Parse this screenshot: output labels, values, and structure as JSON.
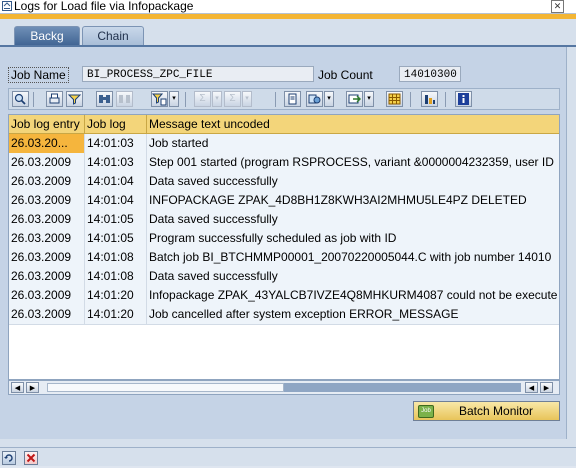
{
  "window": {
    "title": "Logs for Load file via Infopackage",
    "close_glyph": "✕"
  },
  "tabs": [
    {
      "label": "Backg",
      "active": true
    },
    {
      "label": "Chain",
      "active": false
    }
  ],
  "job": {
    "name_label": "Job Name",
    "name_value": "BI_PROCESS_ZPC_FILE",
    "count_label": "Job Count",
    "count_value": "14010300"
  },
  "grid": {
    "columns": [
      "Job log entry",
      "Job log",
      "Message text uncoded"
    ],
    "rows": [
      {
        "date": "26.03.20...",
        "time": "14:01:03",
        "message": "Job started",
        "selected": true
      },
      {
        "date": "26.03.2009",
        "time": "14:01:03",
        "message": "Step 001 started (program RSPROCESS, variant &0000004232359, user ID",
        "selected": false
      },
      {
        "date": "26.03.2009",
        "time": "14:01:04",
        "message": "Data saved successfully",
        "selected": false
      },
      {
        "date": "26.03.2009",
        "time": "14:01:04",
        "message": "INFOPACKAGE ZPAK_4D8BH1Z8KWH3AI2MHMU5LE4PZ DELETED",
        "selected": false
      },
      {
        "date": "26.03.2009",
        "time": "14:01:05",
        "message": "Data saved successfully",
        "selected": false
      },
      {
        "date": "26.03.2009",
        "time": "14:01:05",
        "message": "Program  successfully scheduled as job  with ID",
        "selected": false
      },
      {
        "date": "26.03.2009",
        "time": "14:01:08",
        "message": "Batch job BI_BTCHMMP00001_20070220005044.C with job number 14010",
        "selected": false
      },
      {
        "date": "26.03.2009",
        "time": "14:01:08",
        "message": "Data saved successfully",
        "selected": false
      },
      {
        "date": "26.03.2009",
        "time": "14:01:20",
        "message": "Infopackage ZPAK_43YALCB7IVZE4Q8MHKURM4087 could not be execute",
        "selected": false
      },
      {
        "date": "26.03.2009",
        "time": "14:01:20",
        "message": "Job cancelled after system exception ERROR_MESSAGE",
        "selected": false
      }
    ]
  },
  "scroll": {
    "left_glyph": "◀",
    "right_glyph": "▶",
    "position_fraction": 0.5
  },
  "batch_monitor": {
    "label": "Batch Monitor",
    "icon_text": "Job"
  },
  "toolbar": {
    "icons": [
      "details-icon",
      "print-icon",
      "filter-icon",
      "find-icon",
      "find-next-icon",
      "set-filter-icon",
      "sum-icon",
      "subtotal-icon",
      "print-preview-icon",
      "export-icon",
      "send-icon",
      "layout-icon",
      "chart-icon",
      "info-icon"
    ]
  },
  "colors": {
    "accent": "#f3b534",
    "selected_row": "#f5b53d",
    "header": "#f3d57a",
    "tab_active": "#3f6392"
  }
}
